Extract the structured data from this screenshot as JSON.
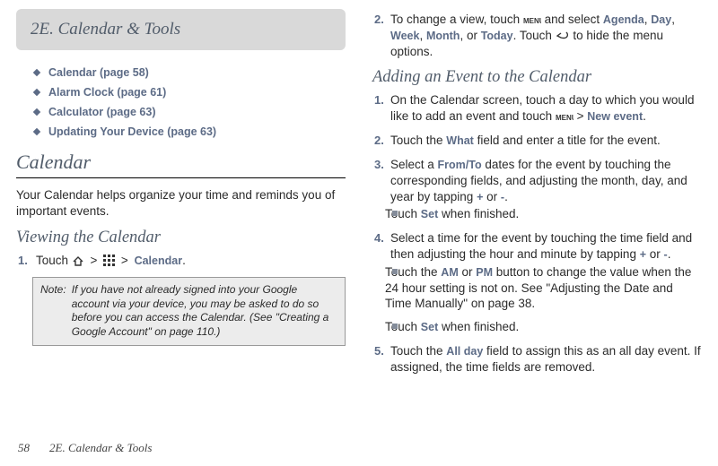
{
  "header": {
    "title": "2E.  Calendar & Tools"
  },
  "toc": [
    "Calendar (page 58)",
    "Alarm Clock (page 61)",
    "Calculator (page 63)",
    "Updating Your Device (page 63)"
  ],
  "calendar": {
    "heading": "Calendar",
    "intro": "Your Calendar helps organize your time and reminds you of important events.",
    "viewing_heading": "Viewing the Calendar",
    "step1_a": "Touch ",
    "step1_b": " > ",
    "step1_c": " > ",
    "step1_d": "Calendar",
    "step1_e": ".",
    "note_label": "Note:",
    "note_text": "If you have not already signed into your Google account via your device, you may be asked to do so before you can access the Calendar. (See \"Creating a Google Account\" on page 110.)"
  },
  "right": {
    "step2_a": "To change a view, touch ",
    "step2_b": " and select ",
    "step2_agenda": "Agenda",
    "step2_c": ", ",
    "step2_day": "Day",
    "step2_d": ", ",
    "step2_week": "Week",
    "step2_e": ", ",
    "step2_month": "Month",
    "step2_f": ", or ",
    "step2_today": "Today",
    "step2_g": ". Touch ",
    "step2_h": " to hide the menu options.",
    "adding_heading": "Adding an Event to the Calendar",
    "a1_a": "On the Calendar screen, touch a day to which you would like to add an event and touch ",
    "a1_b": " > ",
    "a1_newevent": "New event",
    "a1_c": ".",
    "a2_a": "Touch the ",
    "a2_what": "What",
    "a2_b": " field and enter a title for the event.",
    "a3_a": "Select a ",
    "a3_fromto": "From/To",
    "a3_b": " dates for the event by touching the corresponding fields, and adjusting the month, day, and year by tapping ",
    "a3_plus": "+",
    "a3_c": " or ",
    "a3_minus": "-",
    "a3_d": ".",
    "a3_sub_a": "Touch ",
    "a3_set": "Set",
    "a3_sub_b": " when finished.",
    "a4_a": "Select a time for the event by touching the time field and then adjusting the hour and minute by tapping ",
    "a4_b": " or ",
    "a4_c": ".",
    "a4_sub1_a": "Touch the ",
    "a4_am": "AM",
    "a4_sub1_b": " or ",
    "a4_pm": "PM",
    "a4_sub1_c": " button to change the value when the 24 hour setting is not on. See \"Adjusting the Date and Time Manually\" on page 38.",
    "a4_sub2_a": "Touch ",
    "a4_sub2_b": " when finished.",
    "a5_a": "Touch the ",
    "a5_allday": "All day",
    "a5_b": " field to assign this as an all day event. If assigned, the time fields are removed."
  },
  "footer": {
    "page": "58",
    "section": "2E. Calendar & Tools"
  }
}
